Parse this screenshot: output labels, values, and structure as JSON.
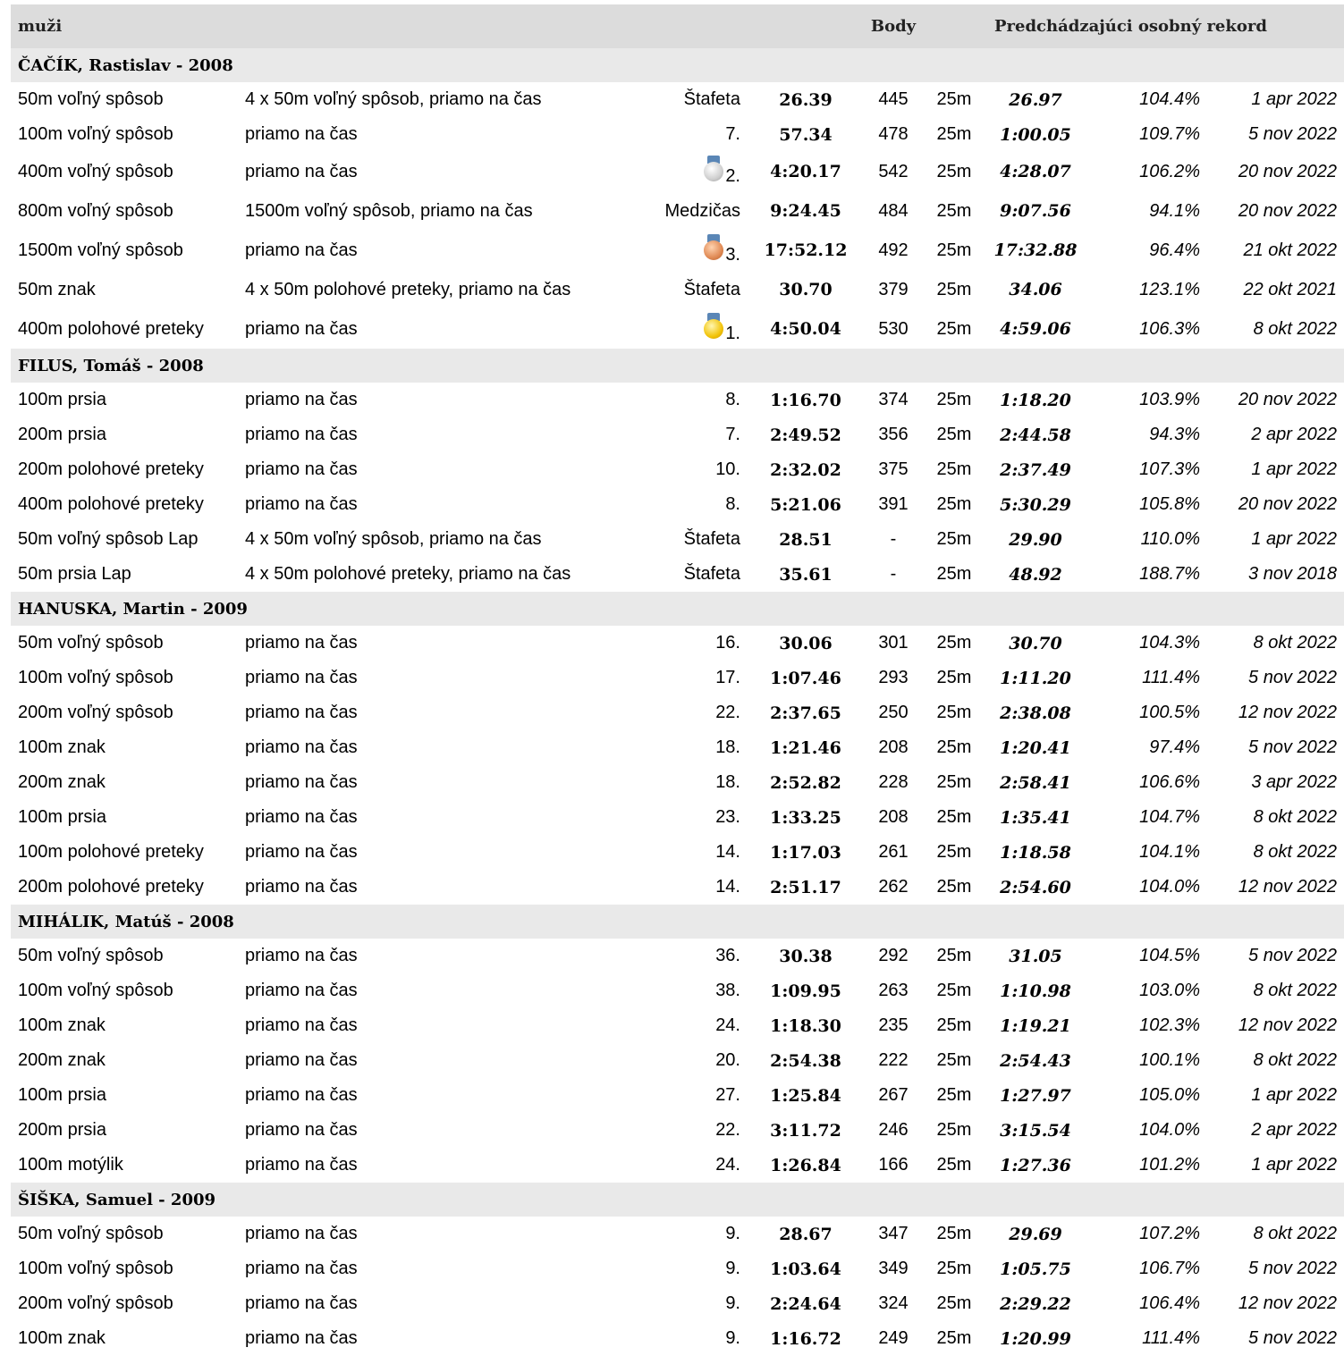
{
  "header": {
    "title": "muži",
    "points_label": "Body",
    "pb_label": "Predchádzajúci osobný rekord"
  },
  "sections": [
    {
      "athlete": "ČAČÍK, Rastislav - 2008",
      "rows": [
        {
          "event": "50m voľný spôsob",
          "race": "4 x 50m voľný spôsob, priamo na čas",
          "place": "Štafeta",
          "time": "26.39",
          "points": "445",
          "pool": "25m",
          "pb": "26.97",
          "pct": "104.4%",
          "date": "1 apr 2022"
        },
        {
          "event": "100m voľný spôsob",
          "race": "priamo na čas",
          "place": "7.",
          "time": "57.34",
          "points": "478",
          "pool": "25m",
          "pb": "1:00.05",
          "pct": "109.7%",
          "date": "5 nov 2022"
        },
        {
          "event": "400m voľný spôsob",
          "race": "priamo na čas",
          "place": "2.",
          "medal": "silver",
          "medal_icon": "silver-medal-icon",
          "time": "4:20.17",
          "points": "542",
          "pool": "25m",
          "pb": "4:28.07",
          "pct": "106.2%",
          "date": "20 nov 2022"
        },
        {
          "event": "800m voľný spôsob",
          "race": "1500m voľný spôsob, priamo na čas",
          "place": "Medzičas",
          "time": "9:24.45",
          "points": "484",
          "pool": "25m",
          "pb": "9:07.56",
          "pct": "94.1%",
          "date": "20 nov 2022"
        },
        {
          "event": "1500m voľný spôsob",
          "race": "priamo na čas",
          "place": "3.",
          "medal": "bronze",
          "medal_icon": "bronze-medal-icon",
          "time": "17:52.12",
          "points": "492",
          "pool": "25m",
          "pb": "17:32.88",
          "pct": "96.4%",
          "date": "21 okt 2022"
        },
        {
          "event": "50m znak",
          "race": "4 x 50m polohové preteky, priamo na čas",
          "place": "Štafeta",
          "time": "30.70",
          "points": "379",
          "pool": "25m",
          "pb": "34.06",
          "pct": "123.1%",
          "date": "22 okt 2021"
        },
        {
          "event": "400m polohové preteky",
          "race": "priamo na čas",
          "place": "1.",
          "medal": "gold",
          "medal_icon": "gold-medal-icon",
          "time": "4:50.04",
          "points": "530",
          "pool": "25m",
          "pb": "4:59.06",
          "pct": "106.3%",
          "date": "8 okt 2022"
        }
      ]
    },
    {
      "athlete": "FILUS, Tomáš - 2008",
      "rows": [
        {
          "event": "100m prsia",
          "race": "priamo na čas",
          "place": "8.",
          "time": "1:16.70",
          "points": "374",
          "pool": "25m",
          "pb": "1:18.20",
          "pct": "103.9%",
          "date": "20 nov 2022"
        },
        {
          "event": "200m prsia",
          "race": "priamo na čas",
          "place": "7.",
          "time": "2:49.52",
          "points": "356",
          "pool": "25m",
          "pb": "2:44.58",
          "pct": "94.3%",
          "date": "2 apr 2022"
        },
        {
          "event": "200m polohové preteky",
          "race": "priamo na čas",
          "place": "10.",
          "time": "2:32.02",
          "points": "375",
          "pool": "25m",
          "pb": "2:37.49",
          "pct": "107.3%",
          "date": "1 apr 2022"
        },
        {
          "event": "400m polohové preteky",
          "race": "priamo na čas",
          "place": "8.",
          "time": "5:21.06",
          "points": "391",
          "pool": "25m",
          "pb": "5:30.29",
          "pct": "105.8%",
          "date": "20 nov 2022"
        },
        {
          "event": "50m voľný spôsob Lap",
          "race": "4 x 50m voľný spôsob, priamo na čas",
          "place": "Štafeta",
          "time": "28.51",
          "points": "-",
          "pool": "25m",
          "pb": "29.90",
          "pct": "110.0%",
          "date": "1 apr 2022"
        },
        {
          "event": "50m prsia Lap",
          "race": "4 x 50m polohové preteky, priamo na čas",
          "place": "Štafeta",
          "time": "35.61",
          "points": "-",
          "pool": "25m",
          "pb": "48.92",
          "pct": "188.7%",
          "date": "3 nov 2018"
        }
      ]
    },
    {
      "athlete": "HANUSKA, Martin - 2009",
      "rows": [
        {
          "event": "50m voľný spôsob",
          "race": "priamo na čas",
          "place": "16.",
          "time": "30.06",
          "points": "301",
          "pool": "25m",
          "pb": "30.70",
          "pct": "104.3%",
          "date": "8 okt 2022"
        },
        {
          "event": "100m voľný spôsob",
          "race": "priamo na čas",
          "place": "17.",
          "time": "1:07.46",
          "points": "293",
          "pool": "25m",
          "pb": "1:11.20",
          "pct": "111.4%",
          "date": "5 nov 2022"
        },
        {
          "event": "200m voľný spôsob",
          "race": "priamo na čas",
          "place": "22.",
          "time": "2:37.65",
          "points": "250",
          "pool": "25m",
          "pb": "2:38.08",
          "pct": "100.5%",
          "date": "12 nov 2022"
        },
        {
          "event": "100m znak",
          "race": "priamo na čas",
          "place": "18.",
          "time": "1:21.46",
          "points": "208",
          "pool": "25m",
          "pb": "1:20.41",
          "pct": "97.4%",
          "date": "5 nov 2022"
        },
        {
          "event": "200m znak",
          "race": "priamo na čas",
          "place": "18.",
          "time": "2:52.82",
          "points": "228",
          "pool": "25m",
          "pb": "2:58.41",
          "pct": "106.6%",
          "date": "3 apr 2022"
        },
        {
          "event": "100m prsia",
          "race": "priamo na čas",
          "place": "23.",
          "time": "1:33.25",
          "points": "208",
          "pool": "25m",
          "pb": "1:35.41",
          "pct": "104.7%",
          "date": "8 okt 2022"
        },
        {
          "event": "100m polohové preteky",
          "race": "priamo na čas",
          "place": "14.",
          "time": "1:17.03",
          "points": "261",
          "pool": "25m",
          "pb": "1:18.58",
          "pct": "104.1%",
          "date": "8 okt 2022"
        },
        {
          "event": "200m polohové preteky",
          "race": "priamo na čas",
          "place": "14.",
          "time": "2:51.17",
          "points": "262",
          "pool": "25m",
          "pb": "2:54.60",
          "pct": "104.0%",
          "date": "12 nov 2022"
        }
      ]
    },
    {
      "athlete": "MIHÁLIK, Matúš - 2008",
      "rows": [
        {
          "event": "50m voľný spôsob",
          "race": "priamo na čas",
          "place": "36.",
          "time": "30.38",
          "points": "292",
          "pool": "25m",
          "pb": "31.05",
          "pct": "104.5%",
          "date": "5 nov 2022"
        },
        {
          "event": "100m voľný spôsob",
          "race": "priamo na čas",
          "place": "38.",
          "time": "1:09.95",
          "points": "263",
          "pool": "25m",
          "pb": "1:10.98",
          "pct": "103.0%",
          "date": "8 okt 2022"
        },
        {
          "event": "100m znak",
          "race": "priamo na čas",
          "place": "24.",
          "time": "1:18.30",
          "points": "235",
          "pool": "25m",
          "pb": "1:19.21",
          "pct": "102.3%",
          "date": "12 nov 2022"
        },
        {
          "event": "200m znak",
          "race": "priamo na čas",
          "place": "20.",
          "time": "2:54.38",
          "points": "222",
          "pool": "25m",
          "pb": "2:54.43",
          "pct": "100.1%",
          "date": "8 okt 2022"
        },
        {
          "event": "100m prsia",
          "race": "priamo na čas",
          "place": "27.",
          "time": "1:25.84",
          "points": "267",
          "pool": "25m",
          "pb": "1:27.97",
          "pct": "105.0%",
          "date": "1 apr 2022"
        },
        {
          "event": "200m prsia",
          "race": "priamo na čas",
          "place": "22.",
          "time": "3:11.72",
          "points": "246",
          "pool": "25m",
          "pb": "3:15.54",
          "pct": "104.0%",
          "date": "2 apr 2022"
        },
        {
          "event": "100m motýlik",
          "race": "priamo na čas",
          "place": "24.",
          "time": "1:26.84",
          "points": "166",
          "pool": "25m",
          "pb": "1:27.36",
          "pct": "101.2%",
          "date": "1 apr 2022"
        }
      ]
    },
    {
      "athlete": "ŠIŠKA, Samuel - 2009",
      "rows": [
        {
          "event": "50m voľný spôsob",
          "race": "priamo na čas",
          "place": "9.",
          "time": "28.67",
          "points": "347",
          "pool": "25m",
          "pb": "29.69",
          "pct": "107.2%",
          "date": "8 okt 2022"
        },
        {
          "event": "100m voľný spôsob",
          "race": "priamo na čas",
          "place": "9.",
          "time": "1:03.64",
          "points": "349",
          "pool": "25m",
          "pb": "1:05.75",
          "pct": "106.7%",
          "date": "5 nov 2022"
        },
        {
          "event": "200m voľný spôsob",
          "race": "priamo na čas",
          "place": "9.",
          "time": "2:24.64",
          "points": "324",
          "pool": "25m",
          "pb": "2:29.22",
          "pct": "106.4%",
          "date": "12 nov 2022"
        },
        {
          "event": "100m znak",
          "race": "priamo na čas",
          "place": "9.",
          "time": "1:16.72",
          "points": "249",
          "pool": "25m",
          "pb": "1:20.99",
          "pct": "111.4%",
          "date": "5 nov 2022"
        }
      ]
    }
  ]
}
